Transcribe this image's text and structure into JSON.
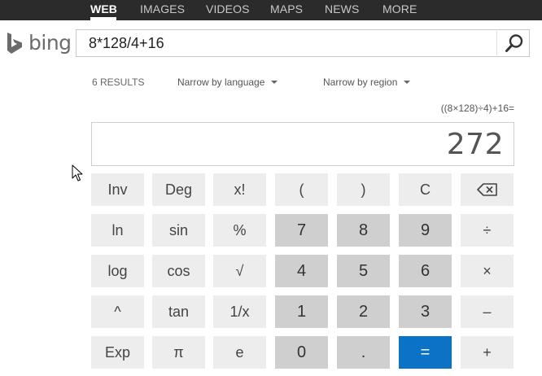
{
  "nav": {
    "items": [
      {
        "label": "WEB",
        "active": true
      },
      {
        "label": "IMAGES",
        "active": false
      },
      {
        "label": "VIDEOS",
        "active": false
      },
      {
        "label": "MAPS",
        "active": false
      },
      {
        "label": "NEWS",
        "active": false
      },
      {
        "label": "MORE",
        "active": false
      }
    ]
  },
  "logo": {
    "text": "bing",
    "icon": "bing-b-logo",
    "color": "#6b6b6b"
  },
  "search": {
    "query": "8*128/4+16",
    "button_icon": "search-icon"
  },
  "results": {
    "count": "6 RESULTS",
    "filters": [
      "Narrow by language",
      "Narrow by region"
    ]
  },
  "calculator": {
    "expression": "((8×128)÷4)+16=",
    "display": "272",
    "rows": [
      [
        "Inv",
        "Deg",
        "x!",
        "(",
        ")",
        "C",
        "⌫"
      ],
      [
        "ln",
        "sin",
        "%",
        "7",
        "8",
        "9",
        "÷"
      ],
      [
        "log",
        "cos",
        "√",
        "4",
        "5",
        "6",
        "×"
      ],
      [
        "^",
        "tan",
        "1/x",
        "1",
        "2",
        "3",
        "–"
      ],
      [
        "Exp",
        "π",
        "e",
        "0",
        ".",
        "=",
        "+"
      ]
    ],
    "colors": {
      "function_key": "#ededed",
      "digit_key": "#cfcfcf",
      "equals_key": "#0b72c6"
    }
  }
}
